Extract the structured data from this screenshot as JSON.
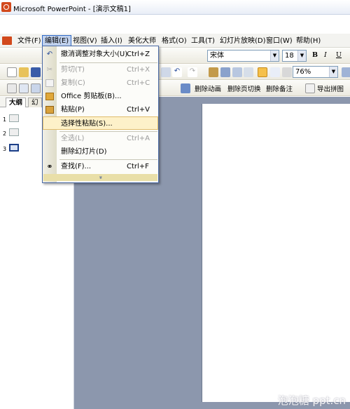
{
  "titlebar": {
    "title": "Microsoft PowerPoint - [演示文稿1]"
  },
  "menubar": {
    "items": [
      {
        "label": "文件(F)"
      },
      {
        "label": "编辑(E)"
      },
      {
        "label": "视图(V)"
      },
      {
        "label": "插入(I)"
      },
      {
        "label": "美化大师"
      },
      {
        "label": "格式(O)"
      },
      {
        "label": "工具(T)"
      },
      {
        "label": "幻灯片放映(D)"
      },
      {
        "label": "窗口(W)"
      },
      {
        "label": "帮助(H)"
      }
    ]
  },
  "format_toolbar": {
    "font_name": "宋体",
    "font_size": "18",
    "bold": "B",
    "italic": "I",
    "underline": "U"
  },
  "standard_toolbar": {
    "zoom": "76%"
  },
  "drawing_toolbar": {
    "delete_animation": "删除动画",
    "delete_transition": "删除页切换",
    "delete_notes": "删除备注",
    "export_image": "导出拼图"
  },
  "leftpane": {
    "tabs": [
      {
        "label": "大纲"
      },
      {
        "label": "幻"
      }
    ],
    "slides": [
      "1",
      "2",
      "3"
    ]
  },
  "edit_menu": {
    "items": [
      {
        "label": "撤消调整对象大小(U)",
        "shortcut": "Ctrl+Z",
        "icon": "undo-icon",
        "disabled": false
      },
      {
        "label": "剪切(T)",
        "shortcut": "Ctrl+X",
        "icon": "scissors-icon",
        "disabled": true
      },
      {
        "label": "复制(C)",
        "shortcut": "Ctrl+C",
        "icon": "copy-icon",
        "disabled": true
      },
      {
        "label": "Office 剪贴板(B)...",
        "shortcut": "",
        "icon": "clipboard-icon",
        "disabled": false
      },
      {
        "label": "粘贴(P)",
        "shortcut": "Ctrl+V",
        "icon": "paste-icon",
        "disabled": false
      },
      {
        "label": "选择性粘贴(S)...",
        "shortcut": "",
        "icon": "",
        "disabled": false
      },
      {
        "label": "全选(L)",
        "shortcut": "Ctrl+A",
        "icon": "",
        "disabled": true
      },
      {
        "label": "删除幻灯片(D)",
        "shortcut": "",
        "icon": "",
        "disabled": false
      },
      {
        "label": "查找(F)...",
        "shortcut": "Ctrl+F",
        "icon": "binoculars-icon",
        "disabled": false
      }
    ],
    "expand_glyph": "»"
  },
  "watermark": "泡泡糖 ppt.cn",
  "colors": {
    "workspace": "#8c97ad",
    "menu_highlight": "#fdf1c9",
    "title_icon": "#d2491c"
  }
}
